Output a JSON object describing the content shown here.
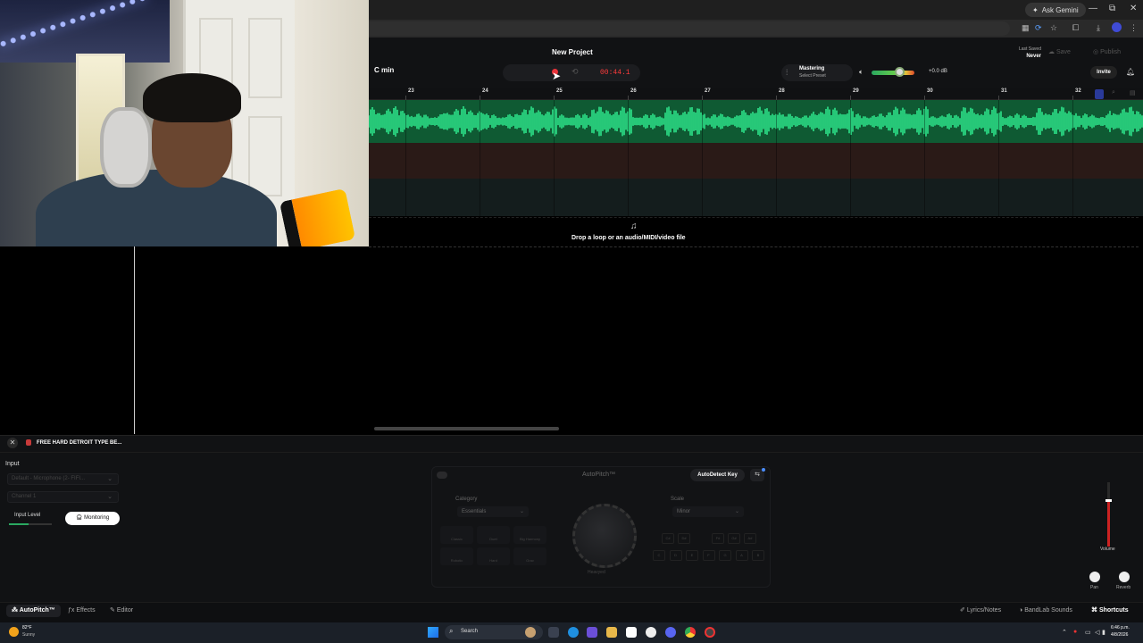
{
  "browser": {
    "ask_gemini": "Ask Gemini",
    "minimize": "—",
    "maximize": "⧉",
    "close": "✕"
  },
  "studio": {
    "project_title": "New Project",
    "key": "C min",
    "time": "00:44.1",
    "mastering_label": "Mastering",
    "preset_label": "Select Preset",
    "volume_db": "+0.0 dB",
    "master_volume_level": 0.65,
    "last_saved_label": "Last Saved",
    "last_saved_value": "Never",
    "save_label": "Save",
    "publish_label": "Publish",
    "invite_label": "Invite"
  },
  "ruler": [
    "23",
    "24",
    "25",
    "26",
    "27",
    "28",
    "29",
    "30",
    "31",
    "32"
  ],
  "drop_zone": {
    "text": "Drop a loop or an audio/MIDI/video file"
  },
  "track_panel": {
    "track_name": "FREE HARD DETROIT TYPE BE...",
    "input_label": "Input",
    "input_device": "Default - Microphone (2- FIFI...",
    "channel": "Channel 1",
    "input_level_label": "Input Level",
    "monitoring_label": "Monitoring"
  },
  "autopitch": {
    "title": "AutoPitch™",
    "autodetect_label": "AutoDetect Key",
    "category_label": "Category",
    "category_value": "Essentials",
    "scale_label": "Scale",
    "scale_value": "Minor",
    "knob_label": "Heavyed",
    "styles": [
      "Classic",
      "Duet",
      "Big Harmony",
      "Robotic",
      "Hard",
      "Grav"
    ],
    "notes_top": [
      "C#",
      "D#",
      "F#",
      "G#",
      "A#"
    ],
    "notes_bottom": [
      "C",
      "D",
      "E",
      "F",
      "G",
      "A",
      "B"
    ]
  },
  "mixer": {
    "volume_label": "Volume",
    "volume_level": 0.72,
    "pan_label": "Pan",
    "reverb_label": "Reverb"
  },
  "bottom_tabs": {
    "autopitch": "AutoPitch™",
    "effects": "Effects",
    "editor": "Editor",
    "lyrics": "Lyrics/Notes",
    "sounds": "BandLab Sounds",
    "shortcuts": "Shortcuts"
  },
  "taskbar": {
    "temperature": "82°F",
    "condition": "Sunny",
    "search_label": "Search",
    "time": "6:46 p.m.",
    "date": "4/8/2026"
  }
}
